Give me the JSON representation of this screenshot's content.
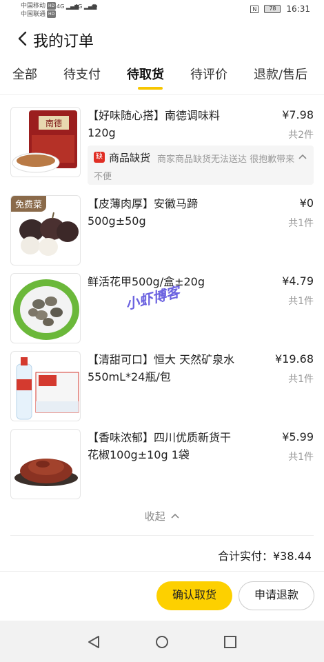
{
  "status_bar": {
    "carrier1": "中国移动",
    "carrier2": "中国联通",
    "hd": "HD",
    "net": "4G",
    "battery": "78",
    "nfc": "N",
    "time": "16:31"
  },
  "header": {
    "title": "我的订单"
  },
  "tabs": [
    {
      "label": "全部"
    },
    {
      "label": "待支付"
    },
    {
      "label": "待取货",
      "active": true
    },
    {
      "label": "待评价"
    },
    {
      "label": "退款/售后"
    }
  ],
  "items": [
    {
      "title": "【好味随心搭】南德调味料120g",
      "price": "¥7.98",
      "qty": "共2件",
      "thumb_icon": "seasoning-pack-image",
      "notice": {
        "badge": "缺",
        "title": "商品缺货",
        "desc": "商家商品缺货无法送达 很抱歉带来不便"
      }
    },
    {
      "title": "【皮薄肉厚】安徽马蹄500g±50g",
      "price": "¥0",
      "qty": "共1件",
      "tag": "免费菜",
      "thumb_icon": "water-chestnut-image"
    },
    {
      "title": "鲜活花甲500g/盒±20g",
      "price": "¥4.79",
      "qty": "共1件",
      "thumb_icon": "clams-image"
    },
    {
      "title": "【清甜可口】恒大 天然矿泉水550mL*24瓶/包",
      "price": "¥19.68",
      "qty": "共1件",
      "thumb_icon": "mineral-water-image"
    },
    {
      "title": "【香味浓郁】四川优质新货干花椒100g±10g 1袋",
      "price": "¥5.99",
      "qty": "共1件",
      "thumb_icon": "sichuan-pepper-image"
    }
  ],
  "collapse_label": "收起",
  "total": "合计实付：¥38.44",
  "buttons": {
    "confirm": "确认取货",
    "refund": "申请退款"
  },
  "watermark": "小虾博客",
  "colors": {
    "accent": "#fdd000",
    "tab_underline": "#f7c600",
    "badge": "#e02e24",
    "watermark": "#6b62e0"
  }
}
